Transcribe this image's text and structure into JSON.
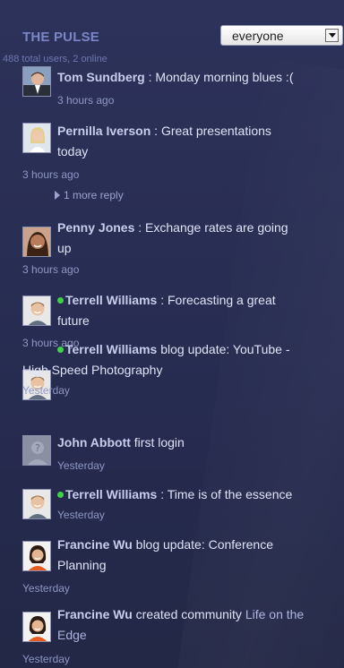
{
  "header": {
    "title": "THE PULSE",
    "subtitle": "488 total users, 2 online",
    "filter_value": "everyone"
  },
  "feed": [
    {
      "name": "Tom Sundberg",
      "online": false,
      "text_line1": " : Monday morning blues :(",
      "text_line2": "",
      "time": "3 hours ago",
      "avatar_icon": "man-suit-avatar"
    },
    {
      "name": "Pernilla Iverson",
      "online": false,
      "text_line1": " : Great presentations",
      "text_line2": "today",
      "time": "3 hours ago",
      "reply": "1 more reply",
      "avatar_icon": "woman-blonde-avatar"
    },
    {
      "name": "Penny Jones",
      "online": false,
      "text_line1": " : Exchange rates are going",
      "text_line2": "up",
      "time": "3 hours ago",
      "avatar_icon": "woman-dark-hair-avatar"
    },
    {
      "name": "Terrell Williams",
      "online": true,
      "text_line1": " : Forecasting a great",
      "text_line2": "future",
      "time": "3 hours ago",
      "avatar_icon": "man-smiling-avatar"
    },
    {
      "name": "Terrell Williams",
      "online": true,
      "text_line1": " blog update: YouTube -",
      "text_line2": "High Speed Photography",
      "time": "Yesterday",
      "avatar_icon": "man-smiling-avatar"
    },
    {
      "name": "John Abbott",
      "online": false,
      "text_line1": " first login",
      "text_line2": "",
      "time": "Yesterday",
      "avatar_icon": "default-user-avatar"
    },
    {
      "name": "Terrell Williams",
      "online": true,
      "text_line1": " : Time is of the essence",
      "text_line2": "",
      "time": "Yesterday",
      "avatar_icon": "man-smiling-avatar"
    },
    {
      "name": "Francine Wu",
      "online": false,
      "text_line1": " blog update: Conference",
      "text_line2": "Planning",
      "time": "Yesterday",
      "avatar_icon": "woman-asian-avatar"
    },
    {
      "name": "Francine Wu",
      "online": false,
      "text_line1": " created community ",
      "link": "Life on the",
      "text_line2": "Edge",
      "time": "Yesterday",
      "avatar_icon": "woman-asian-avatar"
    }
  ],
  "colors": {
    "background": "#2a2f55",
    "title": "#7b86c4",
    "online": "#3dd24a"
  }
}
